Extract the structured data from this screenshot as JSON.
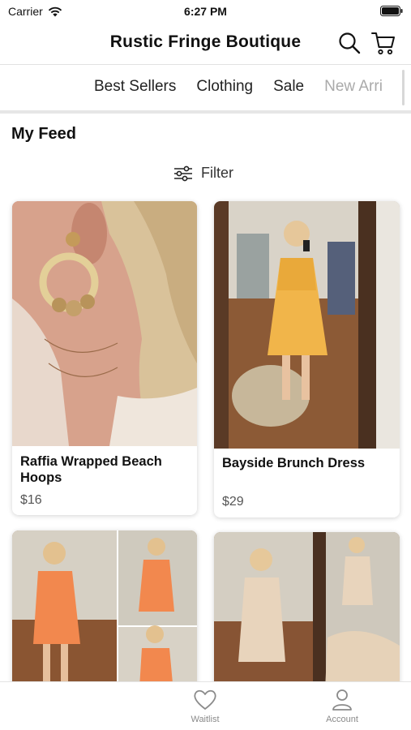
{
  "status": {
    "carrier": "Carrier",
    "time": "6:27 PM"
  },
  "header": {
    "title": "Rustic Fringe Boutique"
  },
  "categories": [
    "Best Sellers",
    "Clothing",
    "Sale",
    "New Arri"
  ],
  "feed": {
    "title": "My Feed",
    "filter_label": "Filter"
  },
  "products": [
    {
      "name": "Raffia Wrapped Beach Hoops",
      "price": "$16"
    },
    {
      "name": "Bayside Brunch Dress",
      "price": "$29"
    }
  ],
  "tabs": [
    {
      "label": "Waitlist",
      "icon": "heart-icon"
    },
    {
      "label": "Account",
      "icon": "person-icon"
    }
  ],
  "colors": {
    "accent": "#111111",
    "muted": "#8a8a8a"
  }
}
